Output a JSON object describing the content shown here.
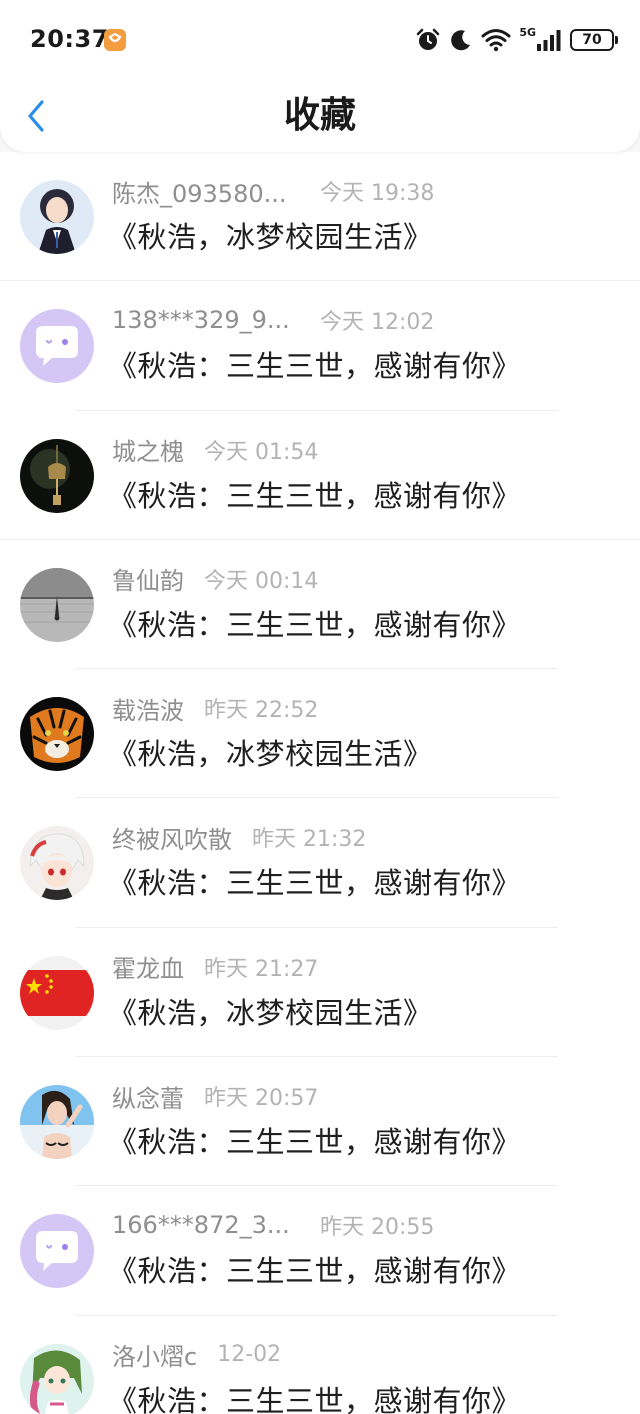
{
  "status_bar": {
    "time": "20:37",
    "network": "5G",
    "battery": "70",
    "icons": [
      "app-badge-icon",
      "alarm-icon",
      "moon-icon",
      "wifi-icon",
      "signal-icon",
      "battery-icon"
    ]
  },
  "nav": {
    "title": "收藏",
    "back_icon": "chevron-left-icon"
  },
  "items": [
    {
      "username": "陈杰_093580...",
      "time": "今天 19:38",
      "title": "《秋浩，冰梦校园生活》",
      "avatar": "anime-boy-suit"
    },
    {
      "username": "138***329_9...",
      "time": "今天 12:02",
      "title": "《秋浩：三生三世，感谢有你》",
      "avatar": "default-chat-bubble"
    },
    {
      "username": "城之槐",
      "time": "今天 01:54",
      "title": "《秋浩：三生三世，感谢有你》",
      "avatar": "wind-chime"
    },
    {
      "username": "鲁仙韵",
      "time": "今天 00:14",
      "title": "《秋浩：三生三世，感谢有你》",
      "avatar": "grey-water-figure"
    },
    {
      "username": "载浩波",
      "time": "昨天 22:52",
      "title": "《秋浩，冰梦校园生活》",
      "avatar": "tiger"
    },
    {
      "username": "终被风吹散",
      "time": "昨天 21:32",
      "title": "《秋浩：三生三世，感谢有你》",
      "avatar": "anime-girl-white-hair"
    },
    {
      "username": "霍龙血",
      "time": "昨天 21:27",
      "title": "《秋浩，冰梦校园生活》",
      "avatar": "china-flag"
    },
    {
      "username": "纵念蕾",
      "time": "昨天 20:57",
      "title": "《秋浩：三生三世，感谢有你》",
      "avatar": "girl-photo"
    },
    {
      "username": "166***872_3...",
      "time": "昨天 20:55",
      "title": "《秋浩：三生三世，感谢有你》",
      "avatar": "default-chat-bubble"
    },
    {
      "username": "洛小熠c",
      "time": "12-02",
      "title": "《秋浩：三生三世，感谢有你》",
      "avatar": "anime-girl-braid"
    }
  ],
  "colors": {
    "accent": "#2a8ee8",
    "username": "#8f8f8f",
    "timestamp": "#b3b3b3",
    "title_text": "#1f1f1f",
    "default_avatar_bg": "#d4c6f5"
  }
}
